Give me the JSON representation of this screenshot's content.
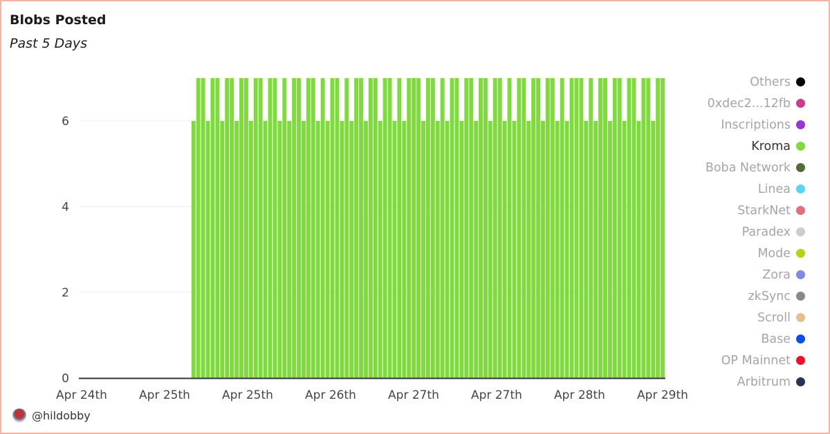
{
  "header": {
    "title": "Blobs Posted",
    "subtitle": "Past 5 Days"
  },
  "footer": {
    "handle": "@hildobby",
    "avatar_icon": "avatar-icon"
  },
  "colors": {
    "frame_border": "#f4b4a4",
    "grid": "#ebebeb",
    "axis": "#333333"
  },
  "legend": [
    {
      "label": "Others",
      "color": "#000000",
      "active": false
    },
    {
      "label": "0xdec2...12fb",
      "color": "#cc3c8c",
      "active": false
    },
    {
      "label": "Inscriptions",
      "color": "#9b35d6",
      "active": false
    },
    {
      "label": "Kroma",
      "color": "#7ddb3c",
      "active": true
    },
    {
      "label": "Boba Network",
      "color": "#556b35",
      "active": false
    },
    {
      "label": "Linea",
      "color": "#5ad4f5",
      "active": false
    },
    {
      "label": "StarkNet",
      "color": "#e5707c",
      "active": false
    },
    {
      "label": "Paradex",
      "color": "#cccccc",
      "active": false
    },
    {
      "label": "Mode",
      "color": "#b6d30f",
      "active": false
    },
    {
      "label": "Zora",
      "color": "#7e8be0",
      "active": false
    },
    {
      "label": "zkSync",
      "color": "#888888",
      "active": false
    },
    {
      "label": "Scroll",
      "color": "#e6bf8c",
      "active": false
    },
    {
      "label": "Base",
      "color": "#0e4ee8",
      "active": false
    },
    {
      "label": "OP Mainnet",
      "color": "#ee0f2d",
      "active": false
    },
    {
      "label": "Arbitrum",
      "color": "#2a3350",
      "active": false
    }
  ],
  "chart_data": {
    "type": "bar",
    "title": "Blobs Posted",
    "subtitle": "Past 5 Days",
    "xlabel": "",
    "ylabel": "",
    "ylim": [
      0,
      7.3
    ],
    "yticks": [
      0,
      2,
      4,
      6
    ],
    "grid": true,
    "legend_position": "right",
    "x_tick_labels": [
      "Apr 24th",
      "Apr 25th",
      "Apr 25th",
      "Apr 26th",
      "Apr 27th",
      "Apr 27th",
      "Apr 28th",
      "Apr 29th"
    ],
    "empty_leading_fraction": 0.192,
    "series": [
      {
        "name": "Kroma",
        "color": "#7ddb3c",
        "values": [
          6,
          7,
          7,
          6,
          7,
          7,
          6,
          7,
          7,
          6,
          7,
          7,
          6,
          7,
          7,
          6,
          7,
          7,
          6,
          7,
          6,
          7,
          7,
          6,
          7,
          7,
          6,
          7,
          6,
          7,
          7,
          6,
          7,
          6,
          7,
          7,
          6,
          7,
          7,
          6,
          7,
          7,
          6,
          7,
          6,
          7,
          7,
          7,
          6,
          7,
          7,
          6,
          7,
          6,
          7,
          7,
          6,
          7,
          7,
          6,
          7,
          7,
          6,
          7,
          7,
          6,
          7,
          6,
          7,
          7,
          6,
          7,
          7,
          6,
          7,
          7,
          6,
          7,
          6,
          7,
          7,
          7,
          6,
          7,
          6,
          7,
          7,
          6,
          7,
          7,
          6,
          7,
          7,
          6,
          7,
          7,
          6,
          7,
          7
        ]
      }
    ]
  }
}
